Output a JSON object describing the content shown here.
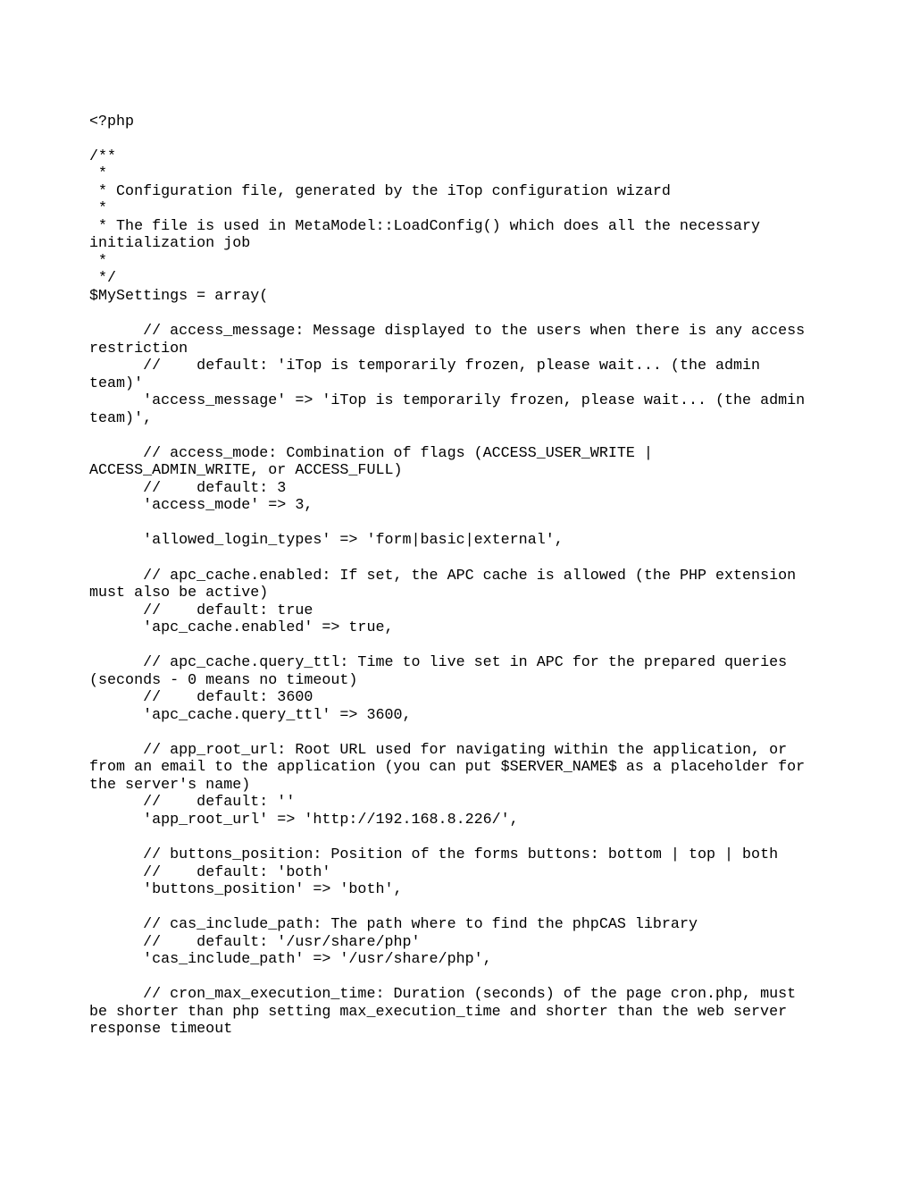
{
  "code": "<?php\n\n/**\n *\n * Configuration file, generated by the iTop configuration wizard\n *\n * The file is used in MetaModel::LoadConfig() which does all the necessary initialization job\n *\n */\n$MySettings = array(\n\n      // access_message: Message displayed to the users when there is any access restriction\n      //    default: 'iTop is temporarily frozen, please wait... (the admin team)'\n      'access_message' => 'iTop is temporarily frozen, please wait... (the admin team)',\n\n      // access_mode: Combination of flags (ACCESS_USER_WRITE | ACCESS_ADMIN_WRITE, or ACCESS_FULL)\n      //    default: 3\n      'access_mode' => 3,\n\n      'allowed_login_types' => 'form|basic|external',\n\n      // apc_cache.enabled: If set, the APC cache is allowed (the PHP extension must also be active)\n      //    default: true\n      'apc_cache.enabled' => true,\n\n      // apc_cache.query_ttl: Time to live set in APC for the prepared queries (seconds - 0 means no timeout)\n      //    default: 3600\n      'apc_cache.query_ttl' => 3600,\n\n      // app_root_url: Root URL used for navigating within the application, or from an email to the application (you can put $SERVER_NAME$ as a placeholder for the server's name)\n      //    default: ''\n      'app_root_url' => 'http://192.168.8.226/',\n\n      // buttons_position: Position of the forms buttons: bottom | top | both\n      //    default: 'both'\n      'buttons_position' => 'both',\n\n      // cas_include_path: The path where to find the phpCAS library\n      //    default: '/usr/share/php'\n      'cas_include_path' => '/usr/share/php',\n\n      // cron_max_execution_time: Duration (seconds) of the page cron.php, must be shorter than php setting max_execution_time and shorter than the web server response timeout"
}
